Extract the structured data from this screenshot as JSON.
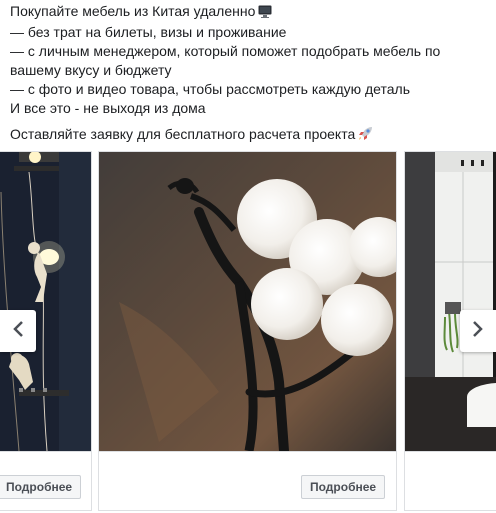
{
  "post": {
    "line1": "Покупайте мебель из Китая удаленно",
    "line1_icon": "computer-monitor-icon",
    "line2": "— без трат на билеты, визы и проживание",
    "line3": "— с личным менеджером, который поможет подобрать мебель по",
    "line4": "вашему вкусу и бюджету",
    "line5": "— с фото и видео товара, чтобы рассмотреть каждую деталь",
    "line6": "И все это - не выходя из дома",
    "cta": "Оставляйте заявку для бесплатного расчета проекта",
    "cta_icon": "rocket-icon"
  },
  "carousel": {
    "cards": [
      {
        "image": "monkey-lamps-photo",
        "button": "Подробнее"
      },
      {
        "image": "figure-floor-lamp-photo",
        "button": "Подробнее"
      },
      {
        "image": "bathroom-interior-photo",
        "button": ""
      }
    ],
    "prev_icon": "chevron-left-icon",
    "next_icon": "chevron-right-icon"
  },
  "colors": {
    "text": "#1c1e21",
    "border": "#dddfe2",
    "button_bg": "#f5f6f7"
  }
}
